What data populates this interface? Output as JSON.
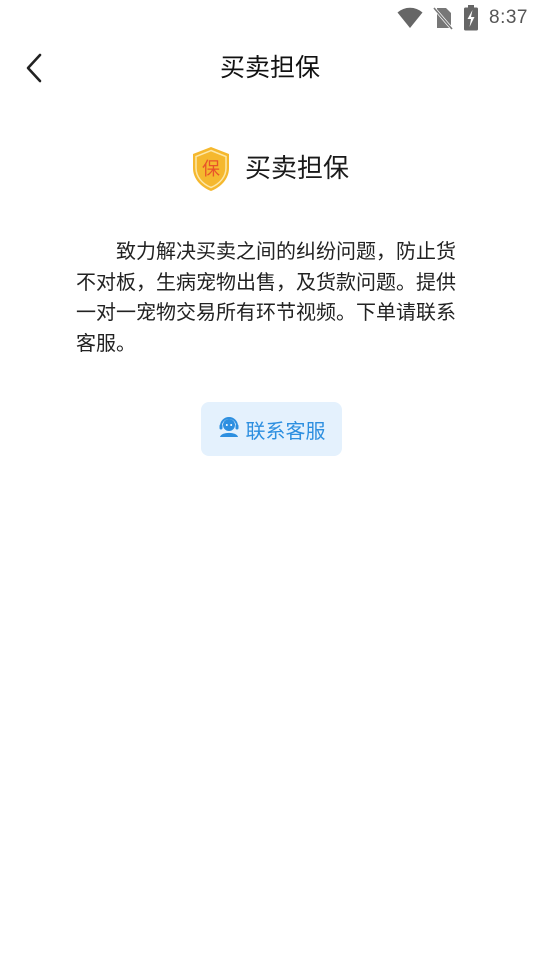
{
  "status_bar": {
    "time": "8:37",
    "icons": [
      "wifi-icon",
      "no-sim-icon",
      "battery-charging-icon"
    ]
  },
  "header": {
    "title": "买卖担保",
    "back_icon": "chevron-left-icon"
  },
  "guarantee": {
    "badge_char": "保",
    "title": "买卖担保",
    "description": "致力解决买卖之间的纠纷问题，防止货不对板，生病宠物出售，及货款问题。提供一对一宠物交易所有环节视频。下单请联系客服。"
  },
  "contact_button": {
    "label": "联系客服",
    "icon": "customer-service-icon"
  },
  "colors": {
    "accent": "#2d8fe0",
    "button_bg": "#e4f1fd",
    "shield_gold": "#f5b82e",
    "shield_text": "#e8542a"
  }
}
